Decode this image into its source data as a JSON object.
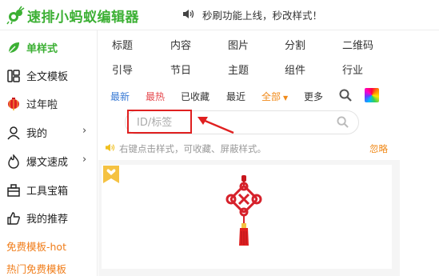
{
  "app": {
    "title": "速排小蚂蚁编辑器",
    "notice": "秒刷功能上线，秒改样式！"
  },
  "sidebar": {
    "items": [
      {
        "label": "单样式",
        "icon": "leaf-icon"
      },
      {
        "label": "全文模板",
        "icon": "layout-icon"
      },
      {
        "label": "过年啦",
        "icon": "lantern-icon"
      },
      {
        "label": "我的",
        "icon": "user-icon"
      },
      {
        "label": "爆文速成",
        "icon": "fire-icon"
      },
      {
        "label": "工具宝箱",
        "icon": "toolbox-icon"
      },
      {
        "label": "我的推荐",
        "icon": "thumbs-up-icon"
      }
    ],
    "links": [
      "免费模板-hot",
      "热门免费模板"
    ]
  },
  "categories": {
    "row1": [
      "标题",
      "内容",
      "图片",
      "分割",
      "二维码"
    ],
    "row2": [
      "引导",
      "节日",
      "主题",
      "组件",
      "行业"
    ]
  },
  "filters": {
    "newest": "最新",
    "hottest": "最热",
    "saved": "已收藏",
    "recent": "最近",
    "all": "全部",
    "more": "更多"
  },
  "search": {
    "placeholder": "ID/标签"
  },
  "tip": {
    "text": "右键点击样式，可收藏、屏蔽样式。",
    "ignore": "忽略"
  },
  "colors": {
    "brand": "#3cb034",
    "accent_orange": "#f08a1a",
    "link_blue": "#3a7bd5",
    "hot_red": "#e5484d",
    "highlight_red": "#e02020"
  }
}
